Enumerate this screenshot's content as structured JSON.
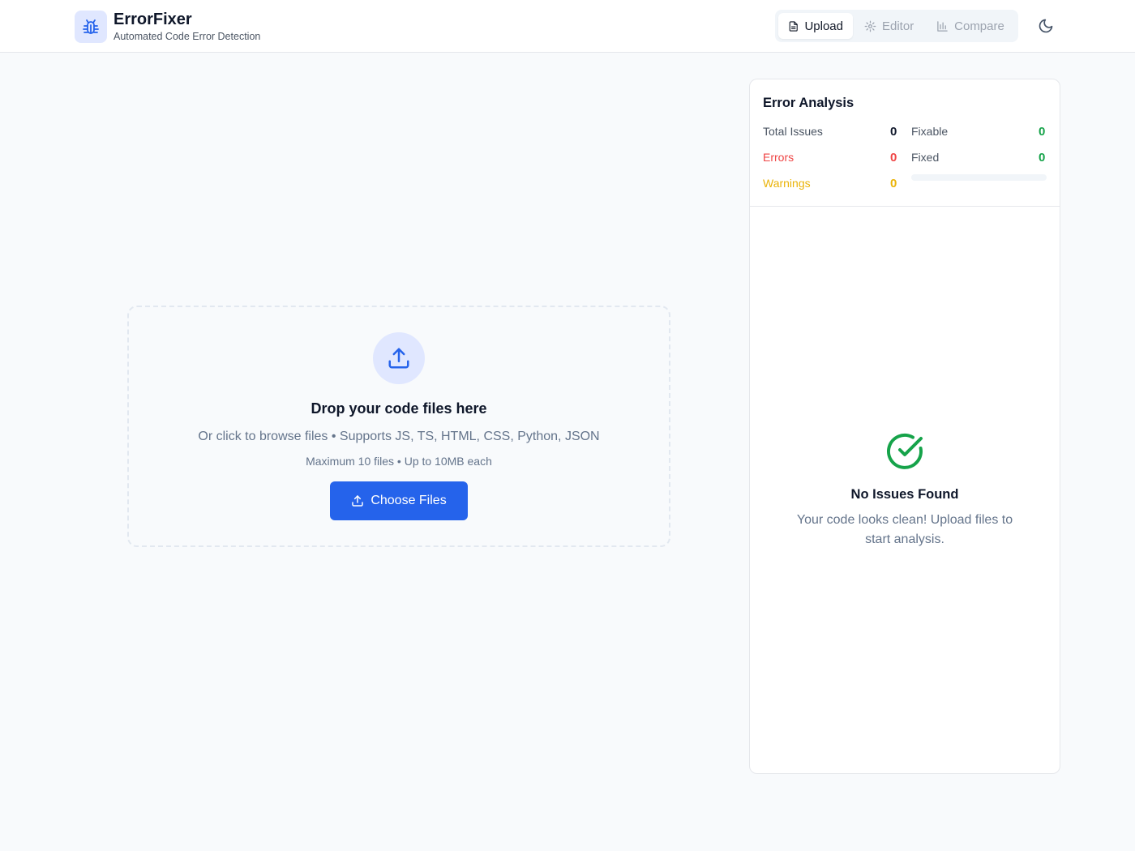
{
  "app": {
    "title": "ErrorFixer",
    "subtitle": "Automated Code Error Detection",
    "logo_icon": "bug-icon"
  },
  "nav": {
    "tabs": [
      {
        "label": "Upload",
        "icon": "file-icon",
        "active": true
      },
      {
        "label": "Editor",
        "icon": "gear-icon",
        "active": false
      },
      {
        "label": "Compare",
        "icon": "bar-chart-icon",
        "active": false
      }
    ],
    "theme_icon": "moon-icon"
  },
  "upload": {
    "icon": "upload-icon",
    "title": "Drop your code files here",
    "description": "Or click to browse files • Supports JS, TS, HTML, CSS, Python, JSON",
    "limits": "Maximum 10 files • Up to 10MB each",
    "button_label": "Choose Files"
  },
  "analysis": {
    "title": "Error Analysis",
    "stats": {
      "total_label": "Total Issues",
      "total_value": "0",
      "errors_label": "Errors",
      "errors_value": "0",
      "warnings_label": "Warnings",
      "warnings_value": "0",
      "fixable_label": "Fixable",
      "fixable_value": "0",
      "fixed_label": "Fixed",
      "fixed_value": "0"
    },
    "fix_progress": 0,
    "empty_title": "No Issues Found",
    "empty_description": "Your code looks clean! Upload files to start analysis."
  },
  "colors": {
    "accent": "#2563eb",
    "error": "#ef4444",
    "warning": "#eab308",
    "success": "#16a34a"
  }
}
